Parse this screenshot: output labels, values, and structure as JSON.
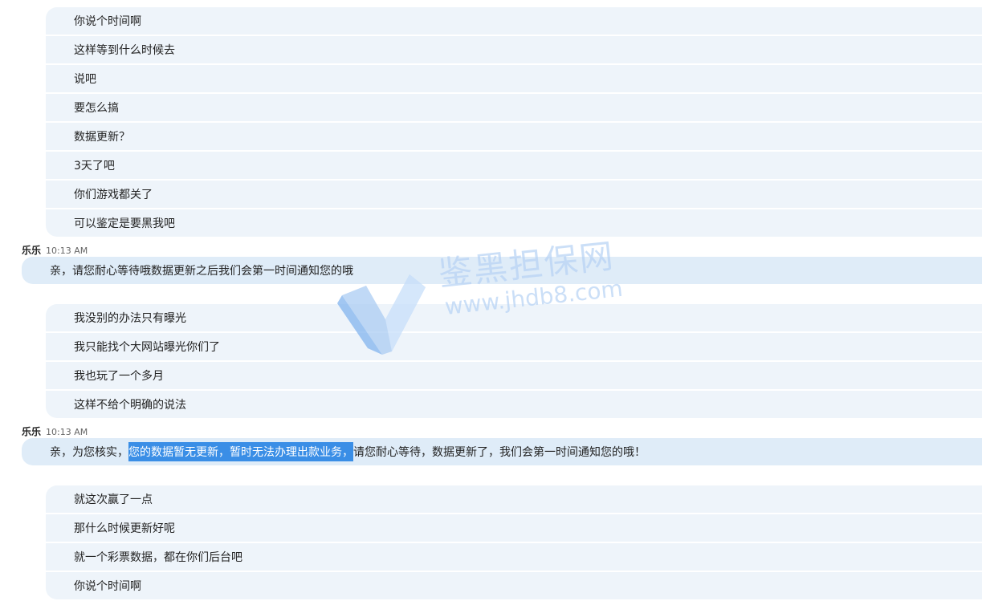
{
  "group1": [
    "你说个时间啊",
    "这样等到什么时候去",
    "说吧",
    "要怎么搞",
    "数据更新？",
    "3天了吧",
    "你们游戏都关了",
    "可以鉴定是要黑我吧"
  ],
  "reply1": {
    "sender": "乐乐",
    "time": "10:13 AM",
    "text": "亲，请您耐心等待哦数据更新之后我们会第一时间通知您的哦"
  },
  "group2": [
    "我没别的办法只有曝光",
    "我只能找个大网站曝光你们了",
    "我也玩了一个多月",
    "这样不给个明确的说法"
  ],
  "reply2": {
    "sender": "乐乐",
    "time": "10:13 AM",
    "text_before": "亲，为您核实，",
    "text_highlight": "您的数据暂无更新，暂时无法办理出款业务，",
    "text_after": "请您耐心等待，数据更新了，我们会第一时间通知您的哦！"
  },
  "group3": [
    "就这次赢了一点",
    "那什么时候更新好呢",
    "就一个彩票数据，都在你们后台吧",
    "你说个时间啊"
  ],
  "watermark": {
    "title": "鉴黑担保网",
    "url": "www.jhdb8.com",
    "color": "#b8d3f5"
  }
}
